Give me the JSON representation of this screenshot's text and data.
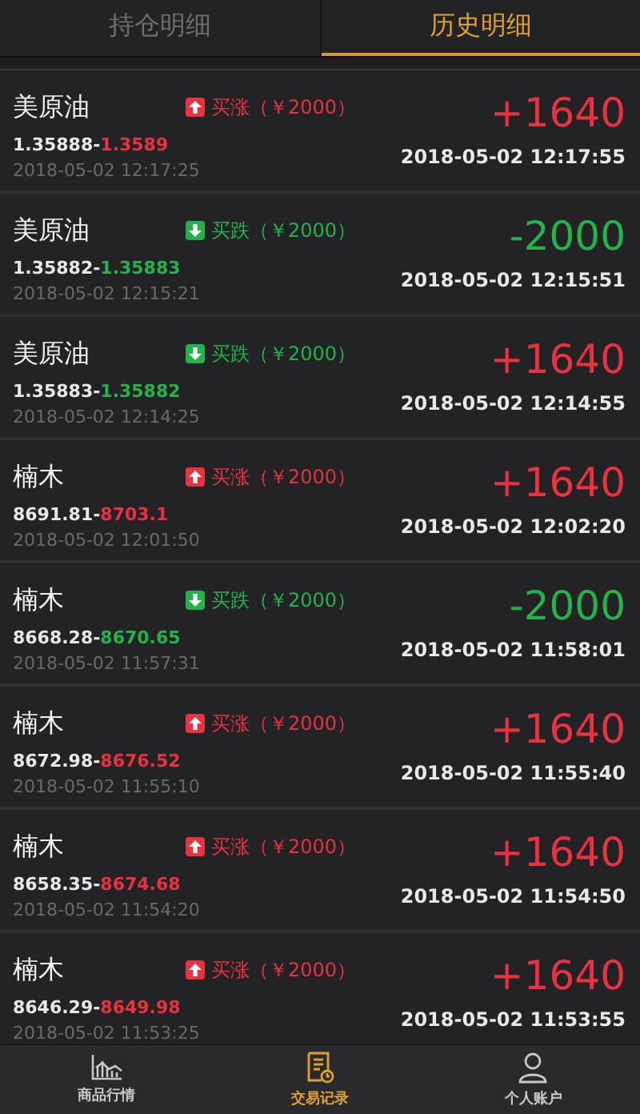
{
  "tabs": [
    {
      "label": "持仓明细",
      "selected": false
    },
    {
      "label": "历史明细",
      "selected": true
    }
  ],
  "trades": [
    {
      "name": "美原油",
      "kind": "up",
      "action": "买涨（￥2000）",
      "open": "1.35888-",
      "close": "1.3589",
      "open_time": "2018-05-02 12:17:25",
      "profit": "+1640",
      "close_time": "2018-05-02 12:17:55"
    },
    {
      "name": "美原油",
      "kind": "down",
      "action": "买跌（￥2000）",
      "open": "1.35882-",
      "close": "1.35883",
      "open_time": "2018-05-02 12:15:21",
      "profit": "-2000",
      "close_time": "2018-05-02 12:15:51"
    },
    {
      "name": "美原油",
      "kind": "down",
      "action": "买跌（￥2000）",
      "open": "1.35883-",
      "close": "1.35882",
      "open_time": "2018-05-02 12:14:25",
      "profit": "+1640",
      "close_time": "2018-05-02 12:14:55"
    },
    {
      "name": "楠木",
      "kind": "up",
      "action": "买涨（￥2000）",
      "open": "8691.81-",
      "close": "8703.1",
      "open_time": "2018-05-02 12:01:50",
      "profit": "+1640",
      "close_time": "2018-05-02 12:02:20"
    },
    {
      "name": "楠木",
      "kind": "down",
      "action": "买跌（￥2000）",
      "open": "8668.28-",
      "close": "8670.65",
      "open_time": "2018-05-02 11:57:31",
      "profit": "-2000",
      "close_time": "2018-05-02 11:58:01"
    },
    {
      "name": "楠木",
      "kind": "up",
      "action": "买涨（￥2000）",
      "open": "8672.98-",
      "close": "8676.52",
      "open_time": "2018-05-02 11:55:10",
      "profit": "+1640",
      "close_time": "2018-05-02 11:55:40"
    },
    {
      "name": "楠木",
      "kind": "up",
      "action": "买涨（￥2000）",
      "open": "8658.35-",
      "close": "8674.68",
      "open_time": "2018-05-02 11:54:20",
      "profit": "+1640",
      "close_time": "2018-05-02 11:54:50"
    },
    {
      "name": "楠木",
      "kind": "up",
      "action": "买涨（￥2000）",
      "open": "8646.29-",
      "close": "8649.98",
      "open_time": "2018-05-02 11:53:25",
      "profit": "+1640",
      "close_time": "2018-05-02 11:53:55"
    }
  ],
  "nav": [
    {
      "label": "商品行情",
      "selected": false
    },
    {
      "label": "交易记录",
      "selected": true
    },
    {
      "label": "个人账户",
      "selected": false
    }
  ]
}
